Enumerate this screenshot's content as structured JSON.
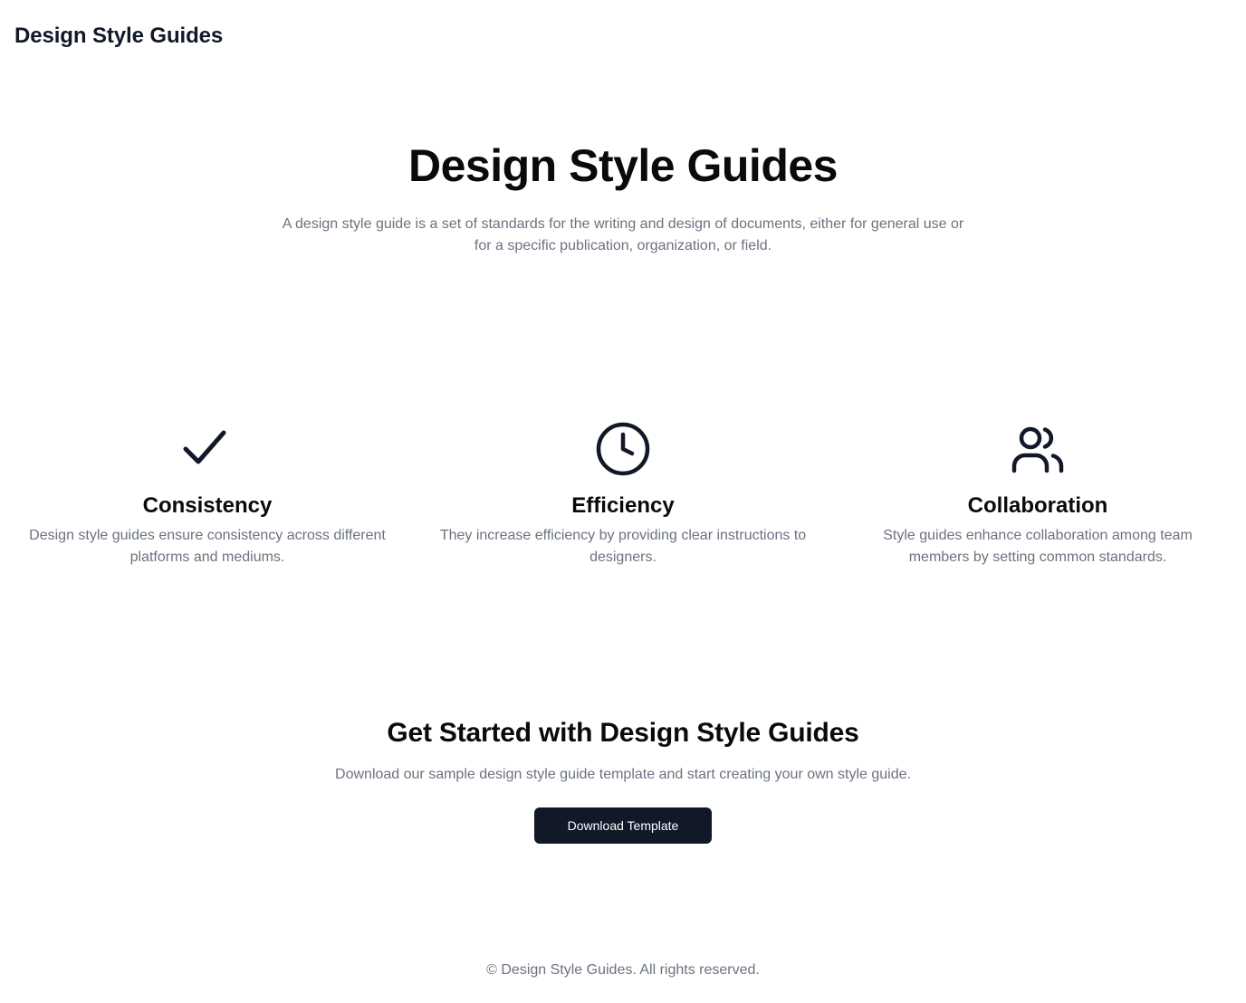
{
  "header": {
    "brand": "Design Style Guides"
  },
  "hero": {
    "title": "Design Style Guides",
    "description": "A design style guide is a set of standards for the writing and design of documents, either for general use or for a specific publication, organization, or field."
  },
  "features": [
    {
      "icon": "check-icon",
      "title": "Consistency",
      "description": "Design style guides ensure consistency across different platforms and mediums."
    },
    {
      "icon": "clock-icon",
      "title": "Efficiency",
      "description": "They increase efficiency by providing clear instructions to designers."
    },
    {
      "icon": "users-icon",
      "title": "Collaboration",
      "description": "Style guides enhance collaboration among team members by setting common standards."
    }
  ],
  "cta": {
    "title": "Get Started with Design Style Guides",
    "description": "Download our sample design style guide template and start creating your own style guide.",
    "button_label": "Download Template"
  },
  "footer": {
    "copyright": "© Design Style Guides. All rights reserved."
  },
  "colors": {
    "primary_dark": "#111827",
    "text_muted": "#6b7280",
    "background": "#ffffff"
  }
}
